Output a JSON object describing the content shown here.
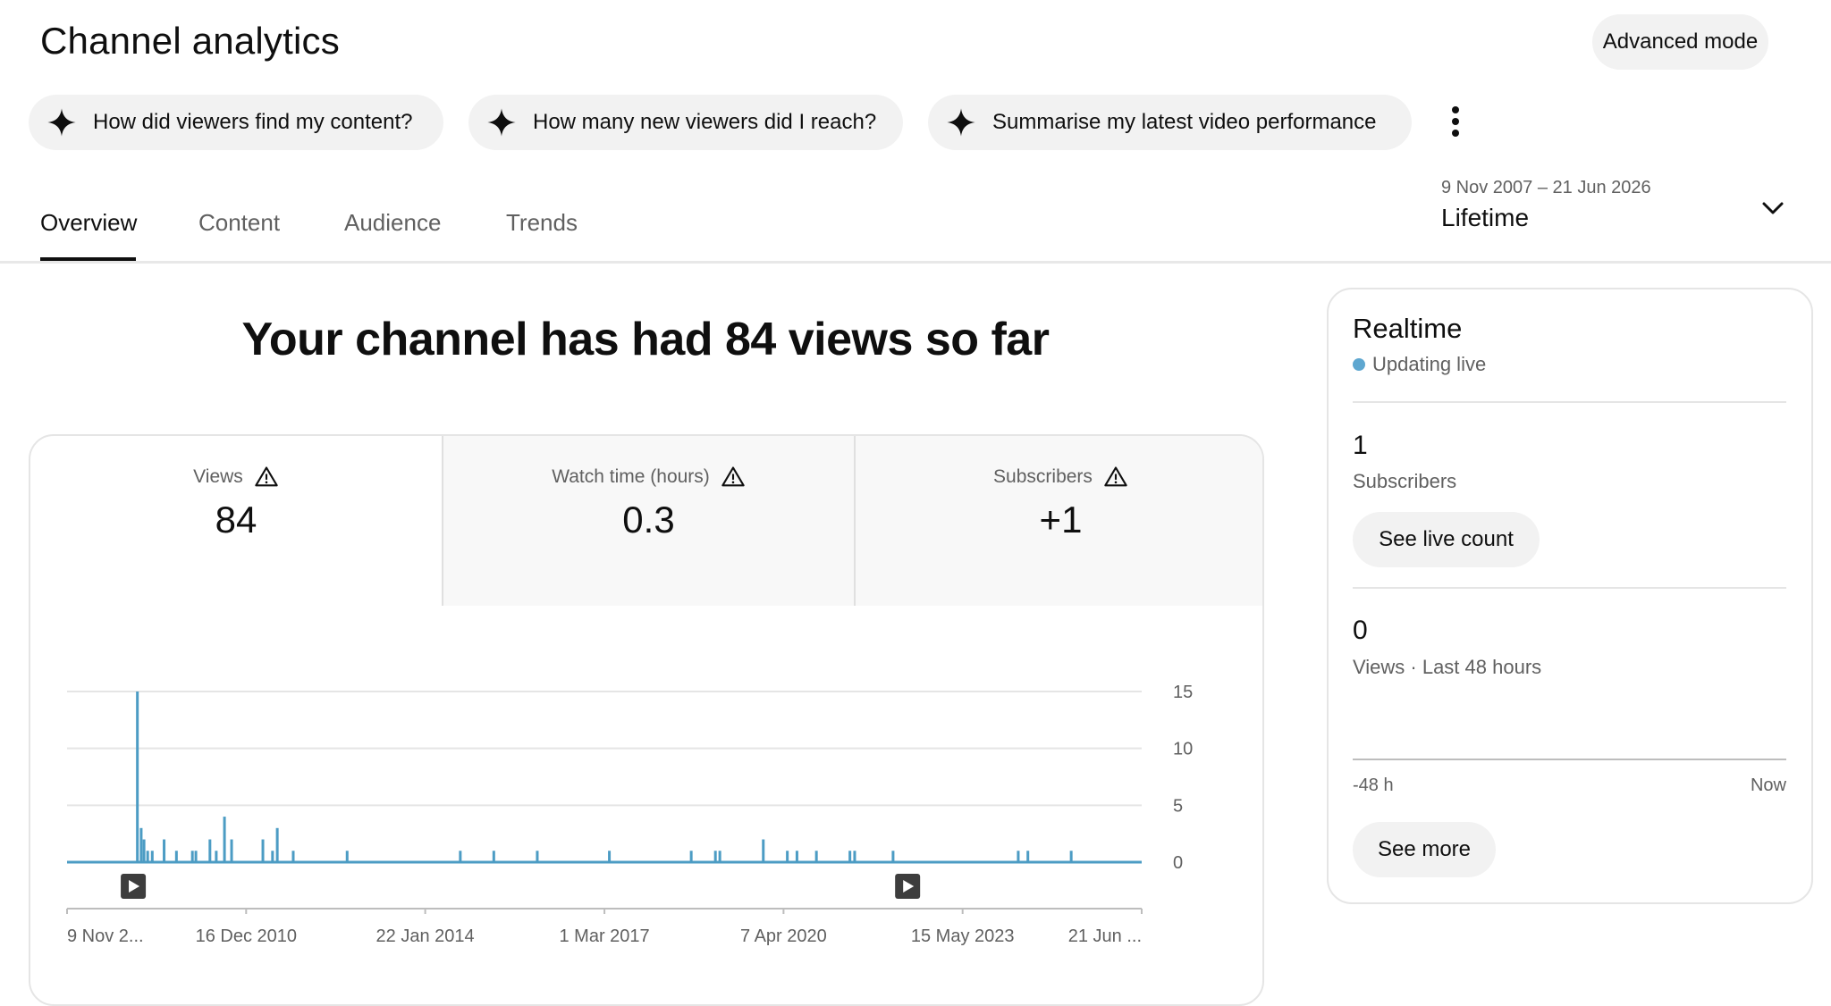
{
  "page_title": "Channel analytics",
  "advanced_mode_label": "Advanced mode",
  "suggestion_chips": [
    {
      "label": "How did viewers find my content?",
      "icon": "sparkle-icon"
    },
    {
      "label": "How many new viewers did I reach?",
      "icon": "sparkle-icon"
    },
    {
      "label": "Summarise my latest video performance",
      "icon": "sparkle-icon"
    }
  ],
  "tabs": [
    {
      "label": "Overview",
      "active": true
    },
    {
      "label": "Content",
      "active": false
    },
    {
      "label": "Audience",
      "active": false
    },
    {
      "label": "Trends",
      "active": false
    }
  ],
  "date_picker": {
    "range": "9 Nov 2007 – 21 Jun 2026",
    "label": "Lifetime"
  },
  "headline": "Your channel has had 84 views so far",
  "metrics": [
    {
      "label": "Views",
      "value": "84",
      "selected": true,
      "icon": "warning-icon"
    },
    {
      "label": "Watch time (hours)",
      "value": "0.3",
      "selected": false,
      "icon": "warning-icon"
    },
    {
      "label": "Subscribers",
      "value": "+1",
      "selected": false,
      "icon": "warning-icon"
    }
  ],
  "chart_data": {
    "type": "bar",
    "series": [
      {
        "name": "Views",
        "color": "#4c9cc4"
      }
    ],
    "x": [
      "2007-11-09",
      "2009-01-27",
      "2009-02-20",
      "2009-03-10",
      "2009-04-02",
      "2009-05-01",
      "2009-07-15",
      "2009-10-01",
      "2010-01-10",
      "2010-02-01",
      "2010-05-01",
      "2010-06-10",
      "2010-08-01",
      "2010-09-15",
      "2011-04-01",
      "2011-06-01",
      "2011-07-01",
      "2011-10-10",
      "2012-09-15",
      "2014-09-01",
      "2015-04-01",
      "2016-01-01",
      "2017-04-01",
      "2018-09-01",
      "2019-02-01",
      "2019-03-01",
      "2019-12-01",
      "2020-05-01",
      "2020-07-01",
      "2020-11-01",
      "2021-06-01",
      "2021-07-01",
      "2022-03-01",
      "2024-05-01",
      "2024-07-01",
      "2025-04-01"
    ],
    "values": [
      0,
      15,
      3,
      2,
      1,
      1,
      2,
      1,
      1,
      1,
      2,
      1,
      4,
      2,
      2,
      1,
      3,
      1,
      1,
      1,
      1,
      1,
      1,
      1,
      1,
      1,
      2,
      1,
      1,
      1,
      1,
      1,
      1,
      1,
      1,
      1
    ],
    "ylim": [
      0,
      15
    ],
    "yticks": [
      "15",
      "10",
      "5",
      "0"
    ],
    "xtick_labels": [
      "9 Nov 2...",
      "16 Dec 2010",
      "22 Jan 2014",
      "1 Mar 2017",
      "7 Apr 2020",
      "15 May 2023",
      "21 Jun ..."
    ],
    "xtick_dates": [
      "2007-11-09",
      "2010-12-16",
      "2014-01-22",
      "2017-03-01",
      "2020-04-07",
      "2023-05-15",
      "2026-06-21"
    ],
    "markers": [
      {
        "date": "2009-01-01",
        "icon": "video-play-icon"
      },
      {
        "date": "2022-06-01",
        "icon": "video-play-icon"
      }
    ],
    "grid": true,
    "y_axis_position": "right"
  },
  "realtime": {
    "title": "Realtime",
    "status": "Updating live",
    "subscribers_value": "1",
    "subscribers_label": "Subscribers",
    "see_live_count": "See live count",
    "views_value": "0",
    "views_label": "Views · Last 48 hours",
    "axis_start": "-48 h",
    "axis_end": "Now",
    "see_more": "See more"
  }
}
